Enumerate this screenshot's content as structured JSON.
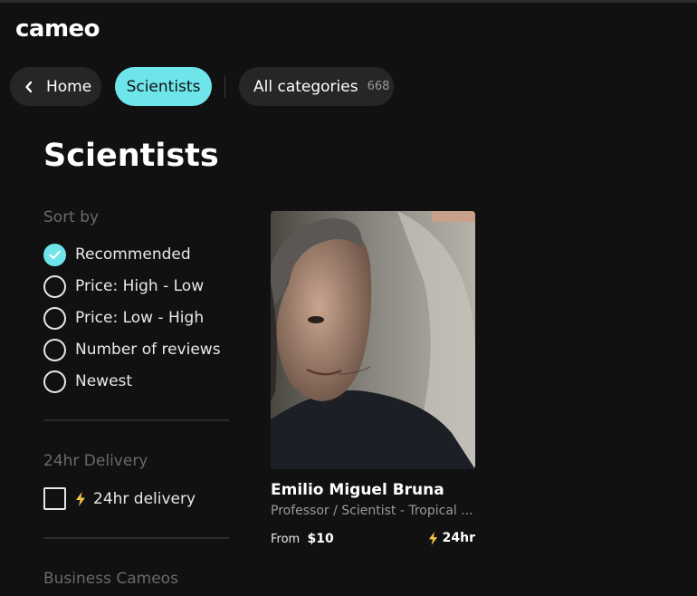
{
  "brand": {
    "logo": "cameo"
  },
  "nav": {
    "home_label": "Home",
    "active_category": "Scientists",
    "all_categories_label": "All categories",
    "all_categories_count": "668"
  },
  "page": {
    "title": "Scientists"
  },
  "sort": {
    "label": "Sort by",
    "options": [
      {
        "label": "Recommended",
        "selected": true
      },
      {
        "label": "Price: High - Low",
        "selected": false
      },
      {
        "label": "Price: Low - High",
        "selected": false
      },
      {
        "label": "Number of reviews",
        "selected": false
      },
      {
        "label": "Newest",
        "selected": false
      }
    ]
  },
  "delivery": {
    "label": "24hr Delivery",
    "option_label": "24hr delivery",
    "checked": false
  },
  "business": {
    "label": "Business Cameos"
  },
  "card": {
    "name": "Emilio Miguel Bruna",
    "subtitle": "Professor / Scientist - Tropical ...",
    "price_prefix": "From",
    "price": "$10",
    "fast_label": "24hr"
  },
  "colors": {
    "background": "#111111",
    "accent": "#6ee5ea",
    "pill": "#262626",
    "bolt": "#f5c542"
  }
}
